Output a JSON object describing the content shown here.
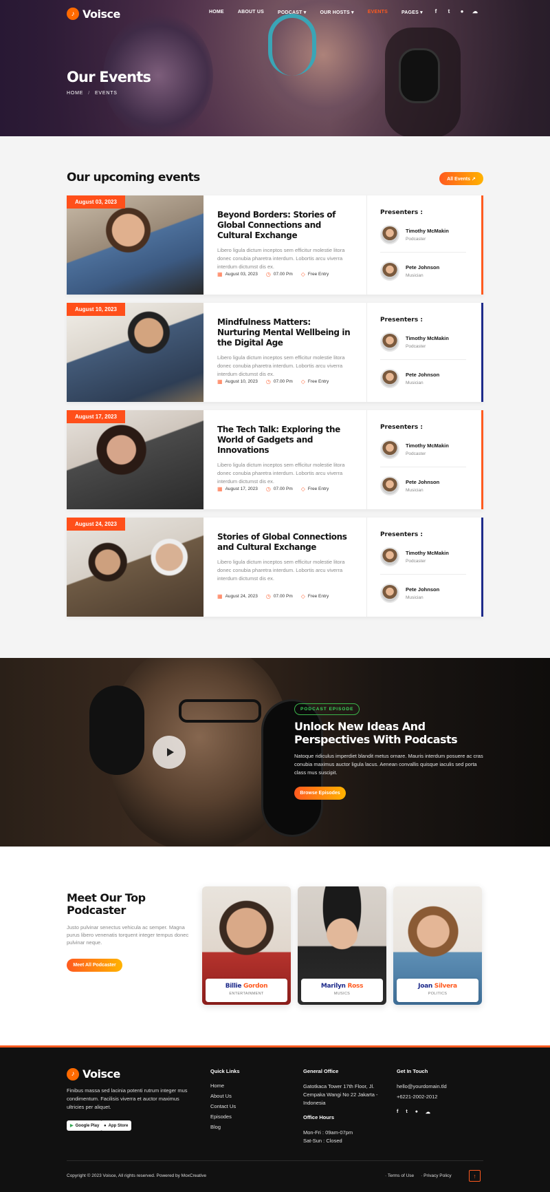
{
  "brand": {
    "name": "Voisce",
    "accent": "#ff5a1f"
  },
  "nav": {
    "items": [
      {
        "label": "HOME"
      },
      {
        "label": "ABOUT US"
      },
      {
        "label": "PODCAST ▾"
      },
      {
        "label": "OUR HOSTS ▾"
      },
      {
        "label": "EVENTS"
      },
      {
        "label": "PAGES ▾"
      }
    ],
    "social": [
      "f",
      "t",
      "●",
      "☁"
    ]
  },
  "hero": {
    "title": "Our Events",
    "breadcrumb_home": "HOME",
    "breadcrumb_sep": "/",
    "breadcrumb_current": "EVENTS"
  },
  "events": {
    "heading": "Our upcoming events",
    "all_button": "All Events ↗",
    "presenters_label": "Presenters :",
    "desc": "Libero ligula dictum inceptos sem efficitur molestie litora donec conubia pharetra interdum. Lobortis arcu viverra interdum dictumst dis ex.",
    "time": "07.00 Pm",
    "entry": "Free Entry",
    "presenters": [
      {
        "name": "Timothy McMakin",
        "role": "Podcaster"
      },
      {
        "name": "Pete Johnson",
        "role": "Musician"
      }
    ],
    "items": [
      {
        "date_badge": "August 03, 2023",
        "title": "Beyond Borders: Stories of Global Connections and Cultural Exchange",
        "date": "August 03, 2023",
        "edge": "#ff5a1f"
      },
      {
        "date_badge": "August 10, 2023",
        "title": "Mindfulness Matters: Nurturing Mental Wellbeing in the Digital Age",
        "date": "August 10, 2023",
        "edge": "#1d2a8a"
      },
      {
        "date_badge": "August 17, 2023",
        "title": "The Tech Talk: Exploring the World of Gadgets and Innovations",
        "date": "August 17, 2023",
        "edge": "#ff5a1f"
      },
      {
        "date_badge": "August 24, 2023",
        "title": "Stories of Global Connections and Cultural Exchange",
        "date": "August 24, 2023",
        "edge": "#1d2a8a"
      }
    ]
  },
  "podcast": {
    "badge": "PODCAST EPISODE",
    "title": "Unlock New Ideas And Perspectives With Podcasts",
    "desc": "Natoque ridiculus imperdiet blandit metus ornare. Mauris interdum posuere ac cras conubia maximus auctor ligula lacus. Aenean convallis quisque iaculis sed porta class mus suscipit.",
    "button": "Browse Episodes"
  },
  "podcasters": {
    "title": "Meet Our Top Podcaster",
    "desc": "Justo pulvinar senectus vehicula ac semper. Magna purus libero venenatis torquent integer tempus donec pulvinar neque.",
    "button": "Meet All Podcaster",
    "people": [
      {
        "first": "Billie",
        "last": "Gordon",
        "category": "ENTERTAINMENT"
      },
      {
        "first": "Marilyn",
        "last": "Ross",
        "category": "MUSICS"
      },
      {
        "first": "Joan",
        "last": "Silvera",
        "category": "POLITICS"
      }
    ]
  },
  "footer": {
    "desc": "Finibus massa sed lacinia potenti rutrum integer mus condimentum. Facilisis viverra et auctor maximus ultricies per aliquet.",
    "google_play": "Google Play",
    "app_store": "App Store",
    "quick_links_title": "Quick Links",
    "quick_links": [
      "Home",
      "About Us",
      "Contact Us",
      "Episodes",
      "Blog"
    ],
    "office_title": "General Office",
    "office_address": "Gatotkaca Tower 17th Floor, Jl. Cempaka Wangi No 22 Jakarta - Indonesia",
    "hours_title": "Office Hours",
    "hours_1": "Mon-Fri : 09am-07pm",
    "hours_2": "Sat-Sun : Closed",
    "contact_title": "Get In Touch",
    "email": "hello@yourdomain.tld",
    "phone": "+6221-2002-2012",
    "copyright": "Copyright © 2023 Voisce, All rights reserved. Powered by MoxCreative",
    "terms": "Terms of Use",
    "privacy": "Privacy Policy"
  }
}
